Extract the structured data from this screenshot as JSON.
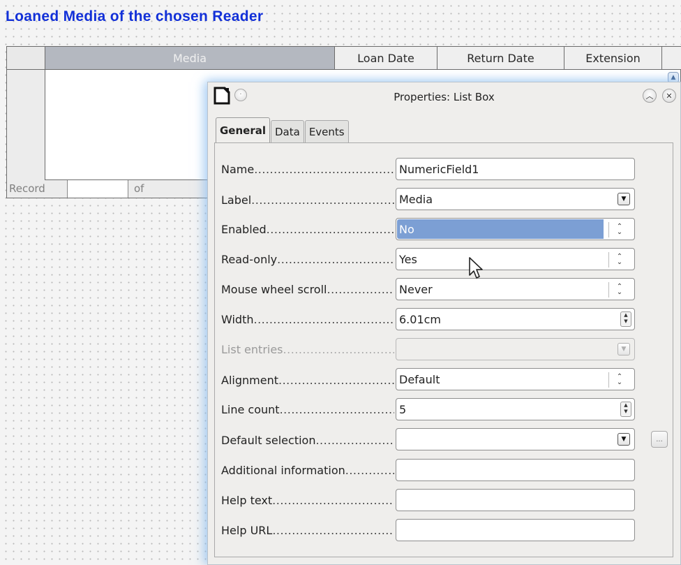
{
  "form": {
    "title": "Loaned Media of the chosen Reader"
  },
  "table": {
    "columns": [
      "Media",
      "Loan Date",
      "Return Date",
      "Extension"
    ],
    "navigator": {
      "record_label": "Record",
      "of_label": "of"
    }
  },
  "dialog": {
    "title": "Properties: List Box",
    "tabs": [
      {
        "label": "General",
        "active": true
      },
      {
        "label": "Data",
        "active": false
      },
      {
        "label": "Events",
        "active": false
      }
    ],
    "properties": [
      {
        "label": "Name",
        "value": "NumericField1",
        "control": "text"
      },
      {
        "label": "Label",
        "value": "Media",
        "control": "dropdown"
      },
      {
        "label": "Enabled",
        "value": "No",
        "control": "select",
        "selected": true
      },
      {
        "label": "Read-only",
        "value": "Yes",
        "control": "select"
      },
      {
        "label": "Mouse wheel scroll",
        "value": "Never",
        "control": "select"
      },
      {
        "label": "Width",
        "value": "6.01cm",
        "control": "spin"
      },
      {
        "label": "List entries",
        "value": "",
        "control": "dropdown",
        "disabled": true
      },
      {
        "label": "Alignment",
        "value": "Default",
        "control": "select"
      },
      {
        "label": "Line count",
        "value": "5",
        "control": "spin"
      },
      {
        "label": "Default selection",
        "value": "",
        "control": "dropdown"
      },
      {
        "label": "Additional information",
        "value": "",
        "control": "text"
      },
      {
        "label": "Help text",
        "value": "",
        "control": "text"
      },
      {
        "label": "Help URL",
        "value": "",
        "control": "text"
      }
    ]
  },
  "colors": {
    "form_title": "#1230d8",
    "selection": "#7c9fd4",
    "media_header": "#b4b8c0"
  }
}
